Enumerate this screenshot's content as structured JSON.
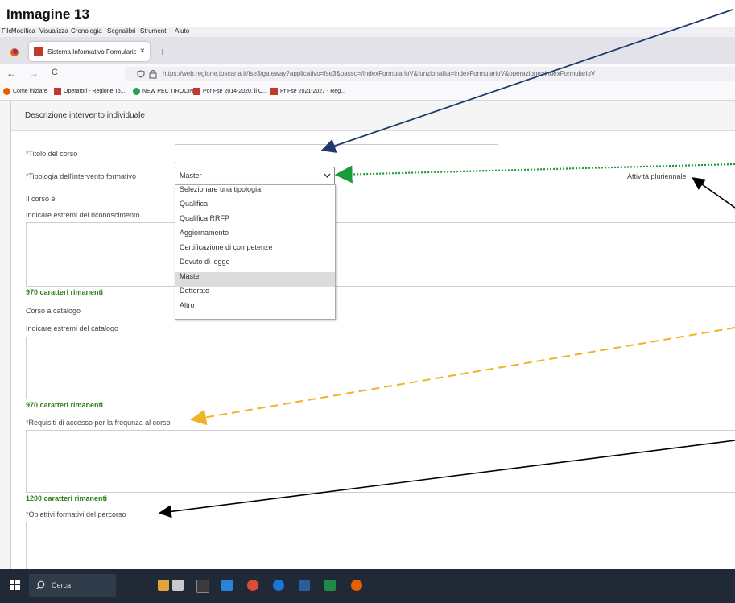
{
  "caption": "Immagine 13",
  "menubar": [
    "File",
    "Modifica",
    "Visualizza",
    "Cronologia",
    "Segnalibri",
    "Strumenti",
    "Aiuto"
  ],
  "tab": {
    "title": "Sistema Informativo Formulario",
    "close": "×",
    "new": "+"
  },
  "nav": {
    "back": "←",
    "forward": "→",
    "reload": "C",
    "url": "https://web.regione.toscana.it/fse3/gateway?applicativo=fse3&passo=/indexFormularioV&funzionalita=indexFormularioV&operazione=indexFormularioV"
  },
  "bookmarks": [
    "Come iniziare",
    "Operatori - Regione To...",
    "NEW PEC TIROCINI",
    "Por Fse 2014-2020, il C...",
    "Pr Fse 2021-2027 - Reg..."
  ],
  "form": {
    "section_title": "Descrizione intervento individuale",
    "star": "*",
    "titolo_label": "Titolo del corso",
    "tipologia_label": "Tipologia dell'intervento formativo",
    "tipologia_value": "Master",
    "pluriennale": "Attività pluriennale",
    "corso_e_label": "Il corso è",
    "estremi_label": "Indicare estremi del riconoscimento",
    "remaining1": "970 caratteri rimanenti",
    "catalogo_label": "Corso a catalogo",
    "estremi_catalogo_label": "Indicare estremi del catalogo",
    "remaining2": "970 caratteri rimanenti",
    "requisiti_label": "Requisiti di accesso per la frequnza al corso",
    "remaining3": "1200 caratteri rimanenti",
    "obiettivi_label": "Obiettivi formativi del percorso"
  },
  "dropdown": [
    {
      "label": "Selezionare una tipologia",
      "selected": false
    },
    {
      "label": "Qualifica",
      "selected": false
    },
    {
      "label": "Qualifica RRFP",
      "selected": false
    },
    {
      "label": "Aggiornamento",
      "selected": false
    },
    {
      "label": "Certificazione di competenze",
      "selected": false
    },
    {
      "label": "Dovuto di legge",
      "selected": false
    },
    {
      "label": "Master",
      "selected": true
    },
    {
      "label": "Dottorato",
      "selected": false
    },
    {
      "label": "Altro",
      "selected": false
    }
  ],
  "taskbar": {
    "search": "Cerca"
  },
  "colors": {
    "required": "#c0392b",
    "remaining": "#2e7d1a",
    "arrow_navy": "#1f3a6e",
    "arrow_green": "#1a9a3a",
    "arrow_orange": "#f0b323",
    "arrow_black": "#000000"
  }
}
